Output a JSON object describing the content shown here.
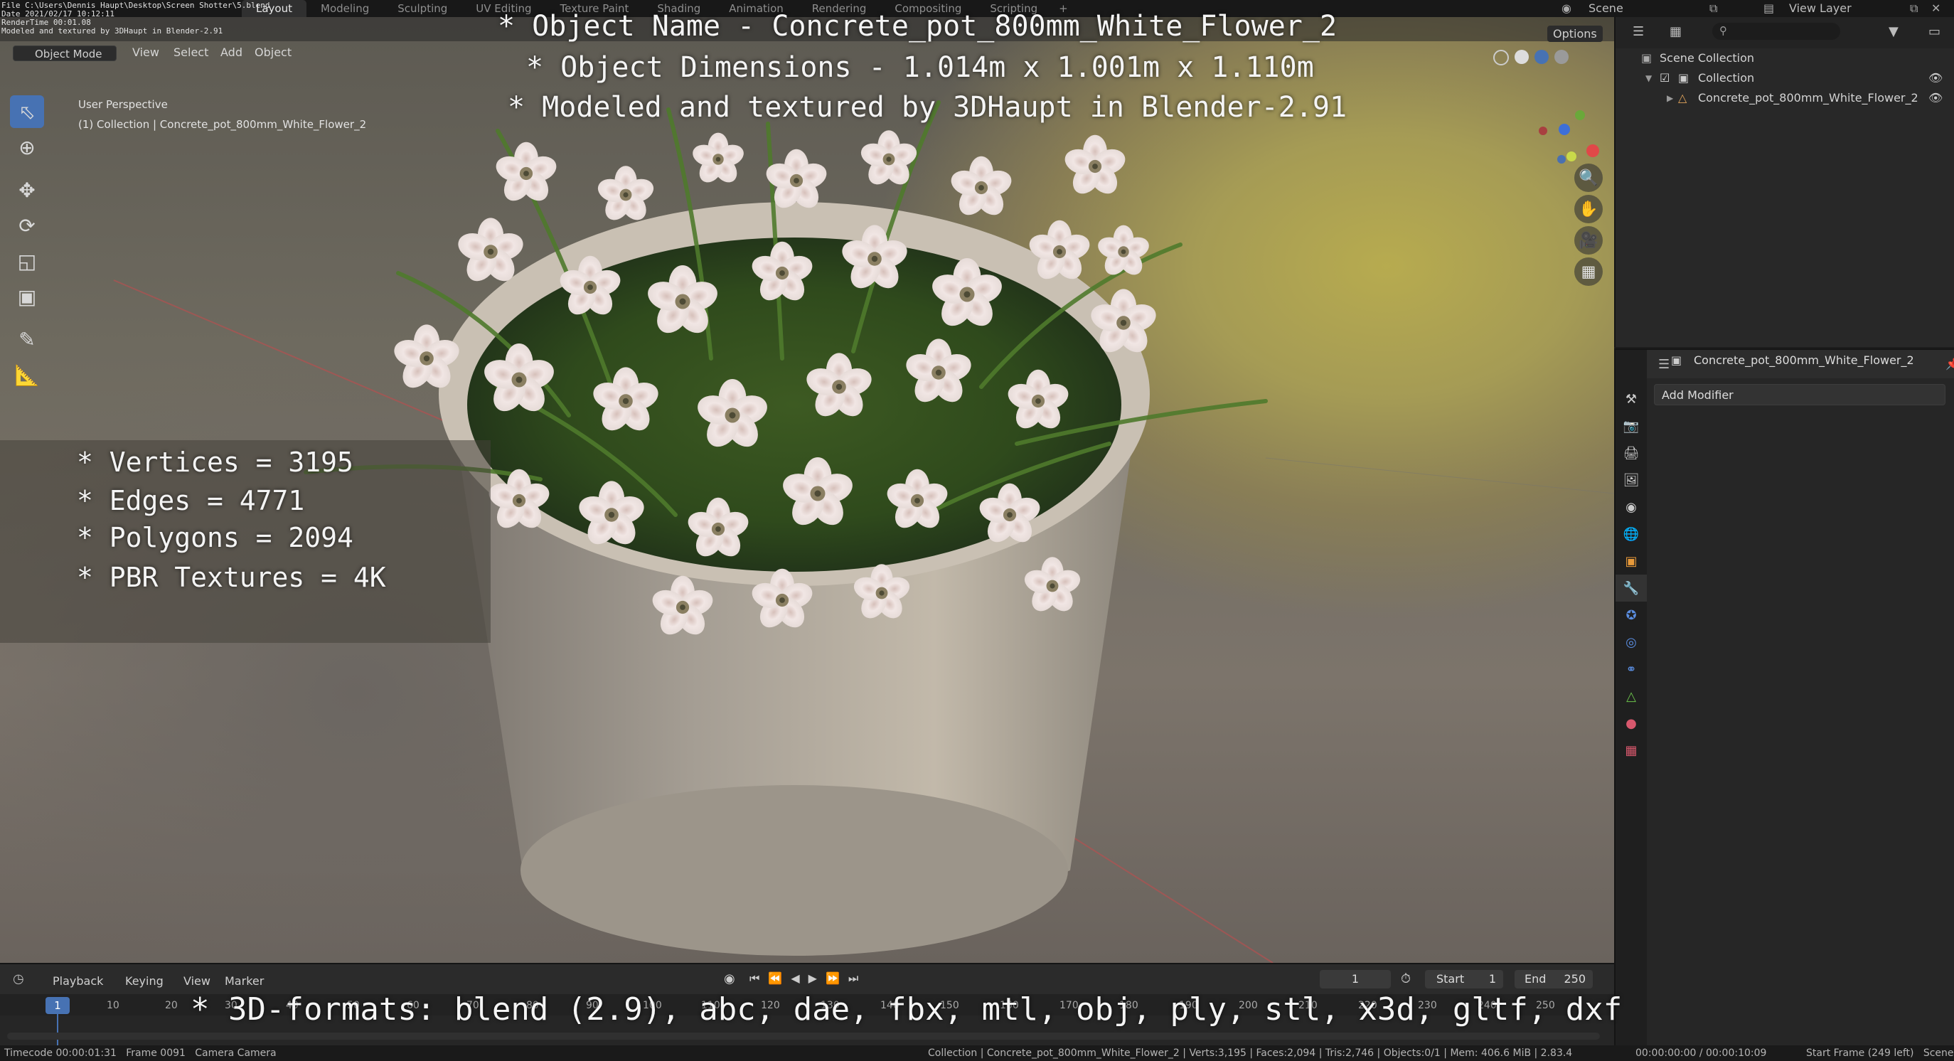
{
  "topbar": {
    "tabs": [
      "Layout",
      "Modeling",
      "Sculpting",
      "UV Editing",
      "Texture Paint",
      "Shading",
      "Animation",
      "Rendering",
      "Compositing",
      "Scripting",
      "+"
    ],
    "active_tab": "Layout",
    "scene": "Scene",
    "view_layer": "View Layer"
  },
  "overlay_info": {
    "file": "File C:\\Users\\Dennis Haupt\\Desktop\\Screen Shotter\\5.blend",
    "date": "Date 2021/02/17 10:12:11",
    "render": "RenderTime 00:01.08",
    "credit": "Modeled and textured by 3DHaupt in Blender-2.91"
  },
  "viewport": {
    "mode": "Object Mode",
    "menus": [
      "View",
      "Select",
      "Add",
      "Object"
    ],
    "options": "Options",
    "perspective": "User Perspective",
    "collection_path": "(1) Collection | Concrete_pot_800mm_White_Flower_2"
  },
  "overlay_text": {
    "name": "* Object Name - Concrete_pot_800mm_White_Flower_2",
    "dims": "* Object Dimensions -  1.014m x 1.001m x 1.110m",
    "model": "* Modeled and textured by 3DHaupt in Blender-2.91",
    "vertices": "* Vertices = 3195",
    "edges": "* Edges = 4771",
    "polygons": "* Polygons = 2094",
    "textures": "* PBR Textures = 4K",
    "formats": "* 3D-formats: blend (2.9), abc, dae, fbx, mtl, obj, ply, stl, x3d, gltf, dxf"
  },
  "outliner": {
    "scene_collection": "Scene Collection",
    "collection": "Collection",
    "object": "Concrete_pot_800mm_White_Flower_2"
  },
  "properties": {
    "object_name": "Concrete_pot_800mm_White_Flower_2",
    "add_modifier": "Add Modifier"
  },
  "timeline": {
    "menus": [
      "Playback",
      "Keying",
      "View",
      "Marker"
    ],
    "current_frame": "1",
    "start_label": "Start",
    "start": "1",
    "end_label": "End",
    "end": "250",
    "ruler": [
      "1",
      "10",
      "20",
      "30",
      "40",
      "50",
      "60",
      "70",
      "80",
      "90",
      "100",
      "110",
      "120",
      "130",
      "140",
      "150",
      "160",
      "170",
      "180",
      "190",
      "200",
      "210",
      "220",
      "230",
      "240",
      "250"
    ]
  },
  "status": {
    "left": "Timecode 00:00:01:31   Frame 0091   Camera Camera",
    "center": "Collection | Concrete_pot_800mm_White_Flower_2 | Verts:3,195 | Faces:2,094 | Tris:2,746 | Objects:0/1 | Mem: 406.6 MiB | 2.83.4",
    "right": "00:00:00:00 / 00:00:10:09",
    "far_right": "Start Frame (249 left)   Scene"
  }
}
